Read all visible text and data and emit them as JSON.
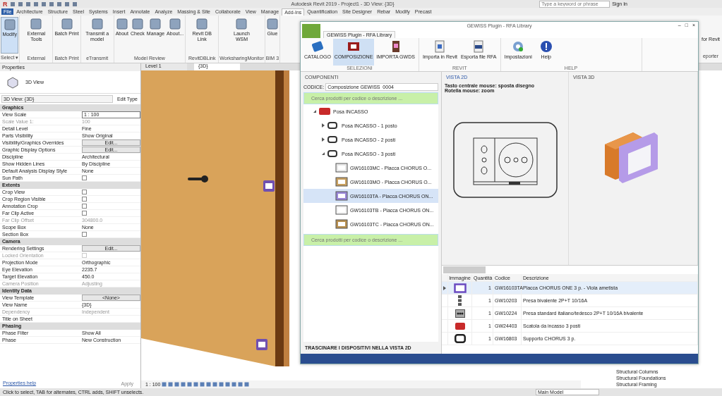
{
  "app": {
    "logo": "R",
    "title": "Autodesk Revit 2019 - Project1 - 3D View: {3D}",
    "search": {
      "placeholder": "Type a keyword or phrase"
    },
    "sign_in": "Sign In"
  },
  "ribbon_tabs": [
    {
      "label": "File",
      "selected": false
    },
    {
      "label": "Architecture",
      "selected": false
    },
    {
      "label": "Structure",
      "selected": false
    },
    {
      "label": "Steel",
      "selected": false
    },
    {
      "label": "Systems",
      "selected": false
    },
    {
      "label": "Insert",
      "selected": false
    },
    {
      "label": "Annotate",
      "selected": false
    },
    {
      "label": "Analyze",
      "selected": false
    },
    {
      "label": "Massing & Site",
      "selected": false
    },
    {
      "label": "Collaborate",
      "selected": false
    },
    {
      "label": "View",
      "selected": false
    },
    {
      "label": "Manage",
      "selected": false
    },
    {
      "label": "Add-Ins",
      "selected": true
    },
    {
      "label": "Quantification",
      "selected": false
    },
    {
      "label": "Site Designer",
      "selected": false
    },
    {
      "label": "Rebar",
      "selected": false
    },
    {
      "label": "Modify",
      "selected": false
    },
    {
      "label": "Precast",
      "selected": false
    }
  ],
  "ribbon_panels": [
    {
      "label": "Select ▾",
      "buttons": [
        {
          "label": "Modify",
          "selected": true
        }
      ]
    },
    {
      "label": "External",
      "buttons": [
        {
          "label": "External Tools",
          "selected": false
        }
      ]
    },
    {
      "label": "Batch Print",
      "buttons": [
        {
          "label": "Batch Print",
          "selected": false
        }
      ]
    },
    {
      "label": "eTransmit",
      "buttons": [
        {
          "label": "Transmit a model",
          "selected": false
        }
      ]
    },
    {
      "label": "Model Review",
      "buttons": [
        {
          "label": "About",
          "selected": false
        },
        {
          "label": "Check",
          "selected": false
        },
        {
          "label": "Manage",
          "selected": false
        },
        {
          "label": "About...",
          "selected": false
        }
      ]
    },
    {
      "label": "RevitDBLink",
      "buttons": [
        {
          "label": "Revit DB Link",
          "selected": false
        }
      ]
    },
    {
      "label": "WorksharingMonitor",
      "buttons": [
        {
          "label": "Launch WSM",
          "selected": false
        }
      ]
    },
    {
      "label": "BIM 3",
      "buttons": [
        {
          "label": "Glue",
          "selected": false
        }
      ]
    }
  ],
  "ribbon_right": {
    "label": "for Revit",
    "panel": "eporter"
  },
  "properties": {
    "title": "Properties",
    "type": "3D View",
    "selector": "3D View: {3D}",
    "edit_type": "Edit Type",
    "sections": [
      {
        "title": "Graphics",
        "rows": [
          {
            "name": "View Scale",
            "value": "1 : 100",
            "kind": "field",
            "disabled": false
          },
          {
            "name": "Scale Value    1:",
            "value": "100",
            "kind": "text",
            "disabled": true
          },
          {
            "name": "Detail Level",
            "value": "Fine",
            "kind": "text",
            "disabled": false
          },
          {
            "name": "Parts Visibility",
            "value": "Show Original",
            "kind": "text",
            "disabled": false
          },
          {
            "name": "Visibility/Graphics Overrides",
            "value": "Edit...",
            "kind": "button",
            "disabled": false
          },
          {
            "name": "Graphic Display Options",
            "value": "Edit...",
            "kind": "button",
            "disabled": false
          },
          {
            "name": "Discipline",
            "value": "Architectural",
            "kind": "text",
            "disabled": false
          },
          {
            "name": "Show Hidden Lines",
            "value": "By Discipline",
            "kind": "text",
            "disabled": false
          },
          {
            "name": "Default Analysis Display Style",
            "value": "None",
            "kind": "text",
            "disabled": false
          },
          {
            "name": "Sun Path",
            "checked": false,
            "kind": "checkbox",
            "disabled": false
          }
        ]
      },
      {
        "title": "Extents",
        "rows": [
          {
            "name": "Crop View",
            "checked": false,
            "kind": "checkbox",
            "disabled": false
          },
          {
            "name": "Crop Region Visible",
            "checked": false,
            "kind": "checkbox",
            "disabled": false
          },
          {
            "name": "Annotation Crop",
            "checked": false,
            "kind": "checkbox",
            "disabled": false
          },
          {
            "name": "Far Clip Active",
            "checked": false,
            "kind": "checkbox",
            "disabled": false
          },
          {
            "name": "Far Clip Offset",
            "value": "304800.0",
            "kind": "text",
            "disabled": true
          },
          {
            "name": "Scope Box",
            "value": "None",
            "kind": "text",
            "disabled": false
          },
          {
            "name": "Section Box",
            "checked": false,
            "kind": "checkbox",
            "disabled": false
          }
        ]
      },
      {
        "title": "Camera",
        "rows": [
          {
            "name": "Rendering Settings",
            "value": "Edit...",
            "kind": "button",
            "disabled": false
          },
          {
            "name": "Locked Orientation",
            "checked": false,
            "kind": "checkbox",
            "disabled": true
          },
          {
            "name": "Projection Mode",
            "value": "Orthographic",
            "kind": "text",
            "disabled": false
          },
          {
            "name": "Eye Elevation",
            "value": "2235.7",
            "kind": "text",
            "disabled": false
          },
          {
            "name": "Target Elevation",
            "value": "450.0",
            "kind": "text",
            "disabled": false
          },
          {
            "name": "Camera Position",
            "value": "Adjusting",
            "kind": "text",
            "disabled": true
          }
        ]
      },
      {
        "title": "Identity Data",
        "rows": [
          {
            "name": "View Template",
            "value": "<None>",
            "kind": "button",
            "disabled": false
          },
          {
            "name": "View Name",
            "value": "{3D}",
            "kind": "text",
            "disabled": false
          },
          {
            "name": "Dependency",
            "value": "Independent",
            "kind": "text",
            "disabled": true
          },
          {
            "name": "Title on Sheet",
            "value": "",
            "kind": "text",
            "disabled": false
          }
        ]
      },
      {
        "title": "Phasing",
        "rows": [
          {
            "name": "Phase Filter",
            "value": "Show All",
            "kind": "text",
            "disabled": false
          },
          {
            "name": "Phase",
            "value": "New Construction",
            "kind": "text",
            "disabled": false
          }
        ]
      }
    ],
    "help_link": "Properties help",
    "apply": "Apply"
  },
  "view_tabs": [
    {
      "label": "Level 1",
      "selected": false
    },
    {
      "label": "{3D}",
      "selected": true
    }
  ],
  "view_scale": "1 : 100",
  "project_browser": [
    "Structural Columns",
    "Structural Foundations",
    "Structural Framing"
  ],
  "status_bar": {
    "text": "Click to select, TAB for alternates, CTRL adds, SHIFT unselects.",
    "model": "Main Model"
  },
  "plugin": {
    "title": "GEWISS Plugin - RFA Library",
    "tab": "GEWISS Plugin - RFA Library",
    "controls": [
      "–",
      "□",
      "×"
    ],
    "groups": [
      {
        "label": "SELEZIONI",
        "buttons": [
          {
            "label": "CATALOGO",
            "kind": "book",
            "selected": false
          },
          {
            "label": "COMPOSIZIONE",
            "kind": "plate",
            "selected": true
          },
          {
            "label": "IMPORTA GWDS",
            "kind": "box",
            "selected": false
          }
        ]
      },
      {
        "label": "REVIT",
        "buttons": [
          {
            "label": "Importa in Revit",
            "kind": "doc",
            "selected": false
          },
          {
            "label": "Esporta file RFA",
            "kind": "rfa",
            "selected": false
          }
        ]
      },
      {
        "label": "HELP",
        "buttons": [
          {
            "label": "Impostazioni",
            "kind": "gear",
            "selected": false
          },
          {
            "label": "Help",
            "kind": "help",
            "selected": false
          }
        ]
      }
    ],
    "components": {
      "title": "COMPONENTI",
      "code_label": "CODICE:",
      "code_value": "Composizione GEWISS_0004",
      "search_placeholder": "Cerca prodotti per codice o descrizione ...",
      "tree": [
        {
          "label": "Posa INCASSO",
          "kind": "box",
          "expanded": true,
          "selected": false,
          "children": [
            {
              "label": "Posa INCASSO - 1 posto",
              "kind": "frame",
              "expanded": false,
              "selected": false
            },
            {
              "label": "Posa INCASSO - 2 posti",
              "kind": "frame",
              "expanded": false,
              "selected": false
            },
            {
              "label": "Posa INCASSO - 3 posti",
              "kind": "frame",
              "expanded": true,
              "selected": false,
              "children": [
                {
                  "label": "GW16103MC - Placca CHORUS O...",
                  "kind": "plate",
                  "color": "#e8e8e8",
                  "selected": false
                },
                {
                  "label": "GW16103MO - Placca CHORUS O...",
                  "kind": "plate",
                  "color": "#c8a060",
                  "selected": false
                },
                {
                  "label": "GW16103TA - Placca CHORUS ON...",
                  "kind": "plate",
                  "color": "#9a88d8",
                  "selected": true
                },
                {
                  "label": "GW16103TB - Placca CHORUS ON...",
                  "kind": "plate",
                  "color": "#f4f4f4",
                  "selected": false
                },
                {
                  "label": "GW16103TC - Placca CHORUS ON...",
                  "kind": "plate",
                  "color": "#b89050",
                  "selected": false
                }
              ]
            }
          ]
        }
      ],
      "search2_placeholder": "Cerca prodotti per codice o descrizione ...",
      "footer": "TRASCINARE I DISPOSITIVI NELLA VISTA 2D"
    },
    "vista2d": {
      "title": "VISTA 2D",
      "hints": [
        "Tasto centrale mouse: sposta disegno",
        "Rotella mouse: zoom"
      ]
    },
    "vista3d": {
      "title": "VISTA 3D"
    },
    "table": {
      "columns": [
        "Immagine",
        "Quantità",
        "Codice",
        "Descrizione"
      ],
      "rows": [
        {
          "kind": "plate",
          "qty": "1",
          "code": "GW16103TA",
          "desc": "Placca CHORUS ONE 3 p. - Viola ametista",
          "selected": true
        },
        {
          "kind": "switch",
          "qty": "1",
          "code": "GW10203",
          "desc": "Presa bivalente 2P+T 10/16A",
          "selected": false
        },
        {
          "kind": "socket",
          "qty": "1",
          "code": "GW10224",
          "desc": "Presa standard italiano/tedesco 2P+T 10/16A bivalente",
          "selected": false
        },
        {
          "kind": "box",
          "qty": "1",
          "code": "GW24403",
          "desc": "Scatola da incasso 3 posti",
          "selected": false
        },
        {
          "kind": "frame",
          "qty": "1",
          "code": "GW16803",
          "desc": "Supporto CHORUS 3 p.",
          "selected": false
        }
      ]
    }
  }
}
